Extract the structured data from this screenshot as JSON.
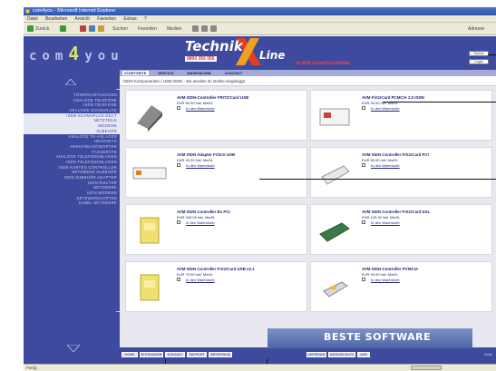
{
  "window": {
    "title": "com4you - Microsoft Internet Explorer",
    "menus": [
      "Datei",
      "Bearbeiten",
      "Ansicht",
      "Favoriten",
      "Extras",
      "?"
    ],
    "toolbar": {
      "back_label": "Zurück",
      "search_label": "Suchen",
      "favorites_label": "Favoriten",
      "media_label": "Medien",
      "address_label": "Adresse"
    },
    "status_text": "Fertig"
  },
  "header": {
    "logo_left": "com",
    "logo_four": "4",
    "logo_right": "you",
    "technik": "Technik",
    "line": "Line",
    "phone": "0800 355 555",
    "tagline": "im Bild schnell bestellbar",
    "btn_1": "Suche",
    "btn_2": "Login"
  },
  "topnav": {
    "items": [
      "STARTSEITE",
      "SERVICE",
      "WARENKORB",
      "KONTAKT"
    ]
  },
  "breadcrumb": "ISDN Komponenten / USB ISDN - Sie wurden im Online eingeloggt",
  "sidebar": {
    "items": [
      "TONERKARTUSCHEN",
      "ANALOGE TELEFONE",
      "ISDN TELEFONE",
      "ANALOGE SCHNURLOS",
      "ISDN SCHNURLOS DECT",
      "NETZTEILE",
      "MODEMS",
      "ZUBEHÖR",
      "ANALOGE TK-ANLAGEN",
      "HEADSETS",
      "ANRUFBEANTWORTER",
      "FAXGERÄTE",
      "ANALOGE TELEFONANLAGEN",
      "ISDN TELEFONANLAGEN",
      "ISDN KARTEN CONTROLLER",
      "NETZWERK ZUBEHÖR",
      "ISDN ZUBEHÖR ADAPTER",
      "ISDN ROUTER",
      "NETZWERK",
      "ISDN MODEMS",
      "NETZWERKKARTEN",
      "KABEL NETZWERK"
    ],
    "highlight_indices": [
      4,
      5,
      6,
      7
    ]
  },
  "products": [
    {
      "name": "AVM ISDN-Controller FRITZ!Card USB",
      "price": "EUR 89,90 inkl. MwSt.",
      "cart": "In den Warenkorb"
    },
    {
      "name": "AVM Fritz!Card PCMCIA 2.0 ISDN",
      "price": "EUR 99,90 inkl. MwSt.",
      "cart": "In den Warenkorb"
    },
    {
      "name": "AVM ISDN Adapter Fritz!X USB",
      "price": "EUR 49,90 inkl. MwSt.",
      "cart": "In den Warenkorb"
    },
    {
      "name": "AVM ISDN Controller Fritz!Card PCI",
      "price": "EUR 69,90 inkl. MwSt.",
      "cart": "In den Warenkorb"
    },
    {
      "name": "AVM ISDN Controller B1 PCI",
      "price": "EUR 349,00 inkl. MwSt.",
      "cart": "In den Warenkorb"
    },
    {
      "name": "AVM ISDN Controller Fritz!Card DSL",
      "price": "EUR 129,90 inkl. MwSt.",
      "cart": "In den Warenkorb"
    },
    {
      "name": "AVM ISDN Controller Fritz!Card USB v2.1",
      "price": "EUR 79,90 inkl. MwSt.",
      "cart": "In den Warenkorb"
    },
    {
      "name": "AVM ISDN-Controller PCMCIA",
      "price": "EUR 99,90 inkl. MwSt.",
      "cart": "In den Warenkorb"
    }
  ],
  "banner": "BESTE SOFTWARE",
  "footer": {
    "buttons": [
      "HOME",
      "SEITENANFANG",
      "KONTAKT",
      "SUPPORT",
      "IMPRESSUM",
      "LIEFERUNG",
      "DATENSCHUTZ",
      "AGB"
    ],
    "end_label": "Seite"
  }
}
